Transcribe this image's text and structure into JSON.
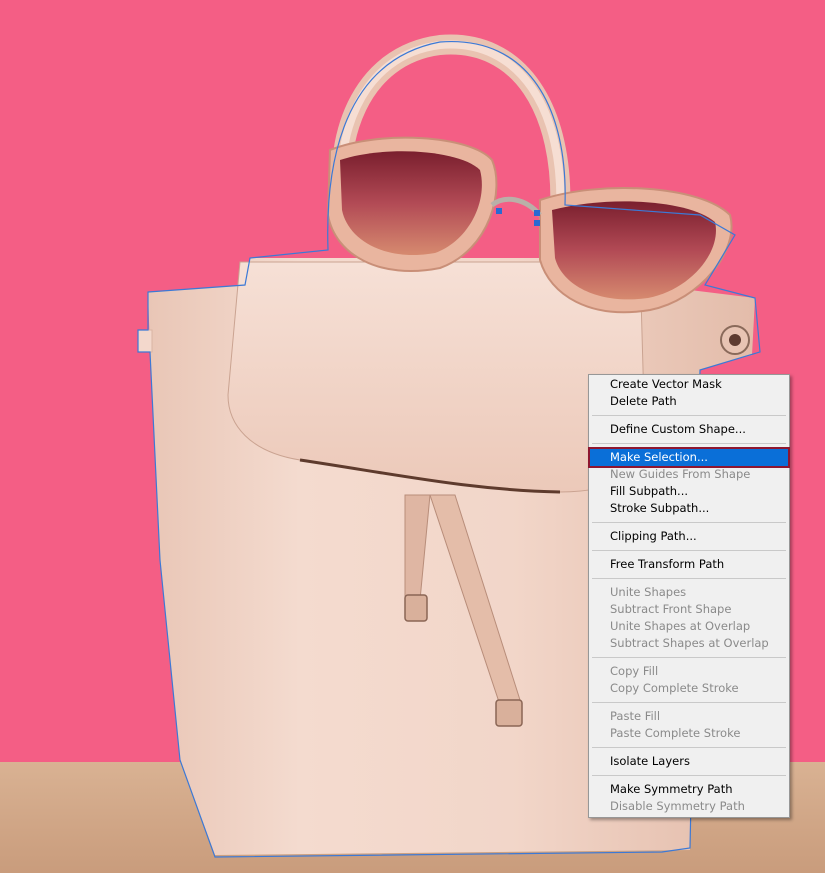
{
  "colors": {
    "background": "#f45e85",
    "table": "#d2a98a",
    "bag": "#f1d4c7",
    "path_outline": "#3c79d6",
    "menu_highlight": "#0a6fd8",
    "menu_focus_border": "#8e1630"
  },
  "canvas": {
    "image_subject": "backpack-photo",
    "path_tool": "path-outline-selected"
  },
  "context_menu": {
    "groups": [
      [
        {
          "label": "Create Vector Mask",
          "enabled": true
        },
        {
          "label": "Delete Path",
          "enabled": true
        }
      ],
      [
        {
          "label": "Define Custom Shape...",
          "enabled": true
        }
      ],
      [
        {
          "label": "Make Selection...",
          "enabled": true,
          "highlighted": true
        },
        {
          "label": "New Guides From Shape",
          "enabled": false
        },
        {
          "label": "Fill Subpath...",
          "enabled": true
        },
        {
          "label": "Stroke Subpath...",
          "enabled": true
        }
      ],
      [
        {
          "label": "Clipping Path...",
          "enabled": true
        }
      ],
      [
        {
          "label": "Free Transform Path",
          "enabled": true
        }
      ],
      [
        {
          "label": "Unite Shapes",
          "enabled": false
        },
        {
          "label": "Subtract Front Shape",
          "enabled": false
        },
        {
          "label": "Unite Shapes at Overlap",
          "enabled": false
        },
        {
          "label": "Subtract Shapes at Overlap",
          "enabled": false
        }
      ],
      [
        {
          "label": "Copy Fill",
          "enabled": false
        },
        {
          "label": "Copy Complete Stroke",
          "enabled": false
        }
      ],
      [
        {
          "label": "Paste Fill",
          "enabled": false
        },
        {
          "label": "Paste Complete Stroke",
          "enabled": false
        }
      ],
      [
        {
          "label": "Isolate Layers",
          "enabled": true
        }
      ],
      [
        {
          "label": "Make Symmetry Path",
          "enabled": true
        },
        {
          "label": "Disable Symmetry Path",
          "enabled": false
        }
      ]
    ]
  }
}
